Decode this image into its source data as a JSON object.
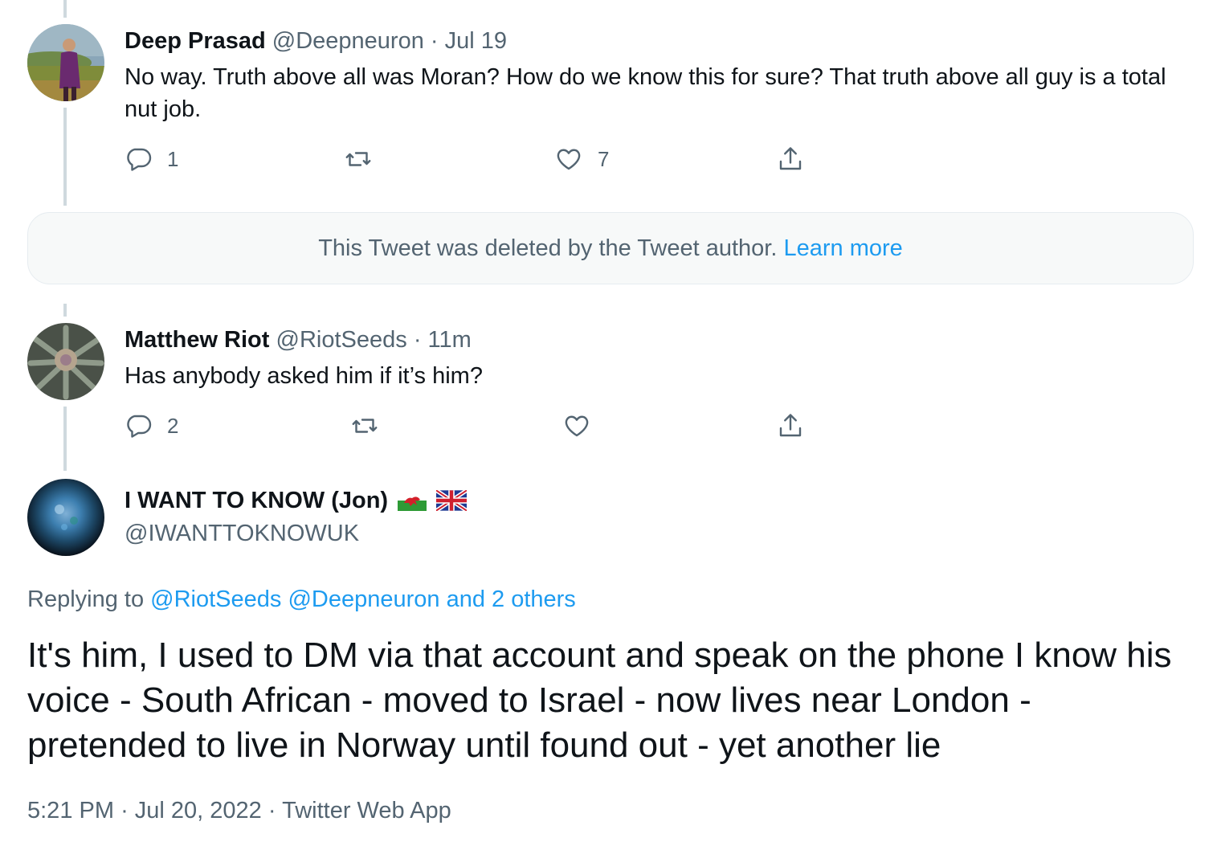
{
  "tweets": [
    {
      "name": "Deep Prasad",
      "handle": "@Deepneuron",
      "sep": "·",
      "time": "Jul 19",
      "text": "No way. Truth above all was Moran? How do we know this for sure? That truth above all guy is a total nut job.",
      "reply_count": "1",
      "retweet_count": "",
      "like_count": "7"
    },
    {
      "name": "Matthew Riot",
      "handle": "@RiotSeeds",
      "sep": "·",
      "time": "11m",
      "text": "Has anybody asked him if it’s him?",
      "reply_count": "2",
      "retweet_count": "",
      "like_count": ""
    }
  ],
  "deleted_notice": {
    "text": "This Tweet was deleted by the Tweet author.",
    "link": "Learn more"
  },
  "main_tweet": {
    "name": "I WANT TO KNOW (Jon)",
    "handle": "@IWANTTOKNOWUK",
    "replying_prefix": "Replying to",
    "replying_to": "@RiotSeeds @Deepneuron and 2 others",
    "text": "It's him, I used to DM via that account and speak on the phone I know his voice  - South African - moved to Israel - now lives near London - pretended to live in Norway until found out - yet another lie",
    "time": "5:21 PM",
    "date": "Jul 20, 2022",
    "source": "Twitter Web App",
    "sep": "·"
  },
  "colors": {
    "accent": "#1d9bf0",
    "muted": "#536471",
    "text": "#0f1419",
    "thread_line": "#cfd9de"
  },
  "icons": [
    "reply-icon",
    "retweet-icon",
    "like-icon",
    "share-icon",
    "wales-flag-icon",
    "uk-flag-icon"
  ]
}
